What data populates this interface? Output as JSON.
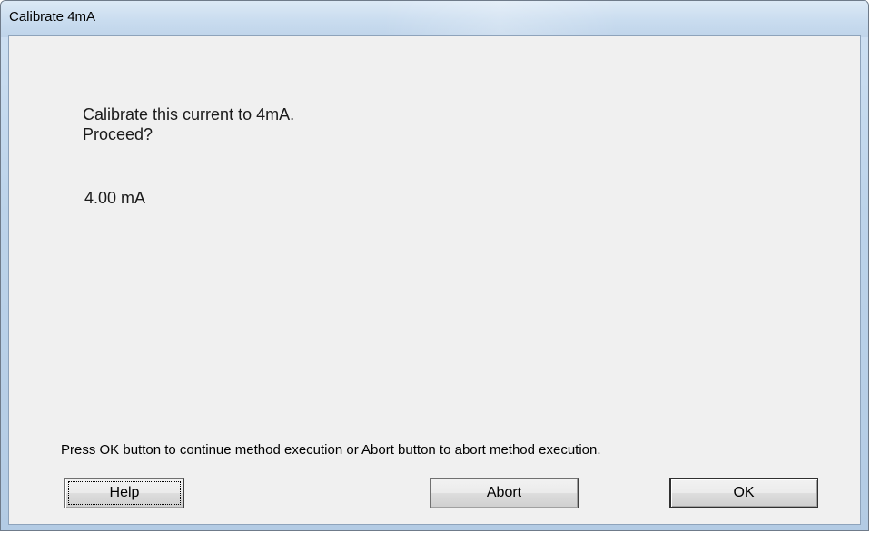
{
  "window": {
    "title": "Calibrate 4mA"
  },
  "message": {
    "line1": "Calibrate this current to 4mA.",
    "line2": "Proceed?",
    "value": "4.00 mA"
  },
  "footer": {
    "instruction": "Press OK button to continue method execution or Abort button to abort method execution."
  },
  "buttons": {
    "help": "Help",
    "abort": "Abort",
    "ok": "OK"
  }
}
